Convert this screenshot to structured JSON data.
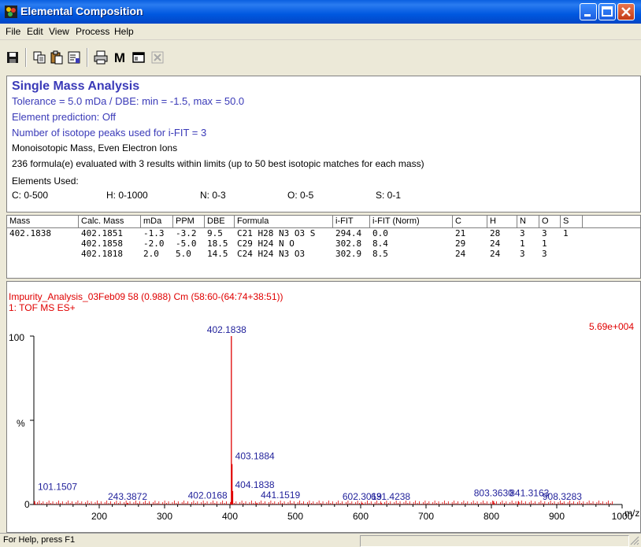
{
  "window": {
    "title": "Elemental Composition"
  },
  "menu": [
    "File",
    "Edit",
    "View",
    "Process",
    "Help"
  ],
  "toolbar_icons": [
    "save-icon",
    "copy-icon",
    "paste-icon",
    "properties-icon",
    "print-icon",
    "m-icon",
    "window-icon",
    "close-x-icon"
  ],
  "toolbar": {
    "m_label": "M"
  },
  "analysis": {
    "heading": "Single Mass Analysis",
    "tolerance": "Tolerance = 5.0 mDa   /   DBE: min = -1.5, max = 50.0",
    "element_prediction": "Element prediction: Off",
    "isotope_peaks": "Number of isotope peaks used for i-FIT = 3",
    "mass_mode": "Monoisotopic Mass, Even Electron Ions",
    "evaluated": "236 formula(e) evaluated with 3 results within limits (up to 50 best isotopic matches for each mass)",
    "elements_label": "Elements Used:",
    "elements": [
      "C: 0-500",
      "H: 0-1000",
      "N: 0-3",
      "O: 0-5",
      "S: 0-1"
    ]
  },
  "table": {
    "columns": [
      "Mass",
      "Calc. Mass",
      "mDa",
      "PPM",
      "DBE",
      "Formula",
      "i-FIT",
      "i-FIT (Norm)",
      "C",
      "H",
      "N",
      "O",
      "S"
    ],
    "rows": [
      [
        "402.1838",
        "402.1851",
        "-1.3",
        "-3.2",
        "9.5",
        "C21 H28 N3 O3 S",
        "294.4",
        "0.0",
        "21",
        "28",
        "3",
        "3",
        "1"
      ],
      [
        "",
        "402.1858",
        "-2.0",
        "-5.0",
        "18.5",
        "C29 H24 N O",
        "302.8",
        "8.4",
        "29",
        "24",
        "1",
        "1",
        ""
      ],
      [
        "",
        "402.1818",
        "2.0",
        "5.0",
        "14.5",
        "C24 H24 N3 O3",
        "302.9",
        "8.5",
        "24",
        "24",
        "3",
        "3",
        ""
      ]
    ]
  },
  "spectrum": {
    "header1": "Impurity_Analysis_03Feb09 58 (0.988) Cm (58:60-(64:74+38:51))",
    "header2": "1: TOF MS ES+",
    "intensity": "5.69e+004",
    "y_top": "100",
    "y_mid": "%",
    "y_zero": "0",
    "x_unit": "m/z",
    "x_ticks": [
      "200",
      "300",
      "400",
      "500",
      "600",
      "700",
      "800",
      "900",
      "1000"
    ]
  },
  "chart_data": {
    "type": "bar",
    "xlabel": "m/z",
    "ylabel": "%",
    "xlim": [
      100,
      1000
    ],
    "ylim": [
      0,
      100
    ],
    "peaks": [
      {
        "mz": 101.1507,
        "intensity": 2,
        "label": "101.1507"
      },
      {
        "mz": 243.3872,
        "intensity": 1,
        "label": "243.3872"
      },
      {
        "mz": 402.0168,
        "intensity": 2,
        "label": "402.0168"
      },
      {
        "mz": 402.1838,
        "intensity": 100,
        "label": "402.1838"
      },
      {
        "mz": 403.1884,
        "intensity": 24,
        "label": "403.1884"
      },
      {
        "mz": 404.1838,
        "intensity": 8,
        "label": "404.1838"
      },
      {
        "mz": 441.1519,
        "intensity": 1,
        "label": "441.1519"
      },
      {
        "mz": 602.3019,
        "intensity": 1,
        "label": "602.3019"
      },
      {
        "mz": 631.4238,
        "intensity": 1,
        "label": "631.4238"
      },
      {
        "mz": 803.363,
        "intensity": 2,
        "label": "803.3630"
      },
      {
        "mz": 841.3163,
        "intensity": 2,
        "label": "841.3163"
      },
      {
        "mz": 908.3283,
        "intensity": 1,
        "label": "908.3283"
      }
    ]
  },
  "status": {
    "text": "For Help, press F1"
  },
  "colors": {
    "title_blue": "#0A5FE0",
    "label_blue": "#3a3ab8",
    "peak_red": "#e00000",
    "spectrum_header_red": "#e00000"
  }
}
